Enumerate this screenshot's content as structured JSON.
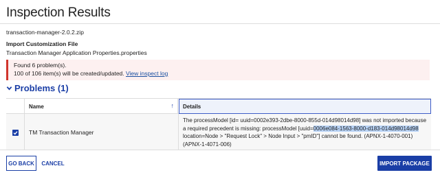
{
  "dialog": {
    "title": "Inspection Results"
  },
  "package": {
    "zip_name": "transaction-manager-2.0.2.zip",
    "customization_label": "Import Customization File",
    "properties_file": "Transaction Manager Application Properties.properties"
  },
  "alert": {
    "line1": "Found 6 problem(s).",
    "line2_prefix": "100 of 106 item(s) will be created/updated.",
    "link_label": "View inspect log",
    "accent_color": "#d0342c"
  },
  "problems": {
    "heading": "Problems (1)",
    "columns": {
      "name": "Name",
      "details": "Details"
    },
    "rows": [
      {
        "name": "TM Transaction Manager",
        "details_before": "The processModel [id= uuid=0002e393-2dbe-8000-855d-014d98014d98] was not imported because a required precedent is missing: processModel [uuid=",
        "details_highlight": "0006e084-1563-8000-d183-014d98014d98",
        "details_after": " location=Node > \"Request Lock\" > Node Input > \"pmID\"] cannot be found. (APNX-1-4070-001) (APNX-1-4071-006)"
      }
    ]
  },
  "footer": {
    "back_label": "GO BACK",
    "cancel_label": "CANCEL",
    "import_label": "IMPORT PACKAGE"
  },
  "colors": {
    "primary": "#1a3ea6",
    "alert_bg": "#fdf0f0",
    "highlight": "#b7d2f5"
  },
  "icons": {
    "chevron": "chevron-down-icon",
    "sort": "sort-up-arrow-icon",
    "checkbox": "checkbox-checked-icon"
  }
}
